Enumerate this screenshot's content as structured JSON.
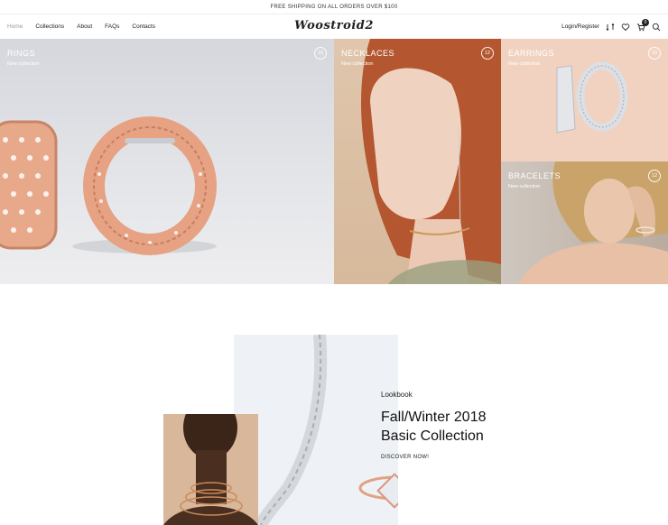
{
  "topbar": {
    "text": "FREE SHIPPING ON ALL ORDERS OVER $100"
  },
  "nav": {
    "links": [
      "Home",
      "Collections",
      "About",
      "FAQs",
      "Contacts"
    ],
    "logo": "Woostroid2",
    "login": "Login/Register",
    "cart_count": "0"
  },
  "tiles": {
    "rings": {
      "title": "RINGS",
      "subtitle": "New collection",
      "count": "16"
    },
    "necklaces": {
      "title": "NECKLACES",
      "subtitle": "New collection",
      "count": "12"
    },
    "earrings": {
      "title": "EARRINGS",
      "subtitle": "New collection",
      "count": "10"
    },
    "bracelets": {
      "title": "BRACELETS",
      "subtitle": "New collection",
      "count": "12"
    }
  },
  "lookbook": {
    "label": "Lookbook",
    "title_line1": "Fall/Winter 2018",
    "title_line2": "Basic Collection",
    "cta": "DISCOVER NOW!"
  },
  "colors": {
    "rose_gold": "#d99473",
    "text": "#222222"
  }
}
